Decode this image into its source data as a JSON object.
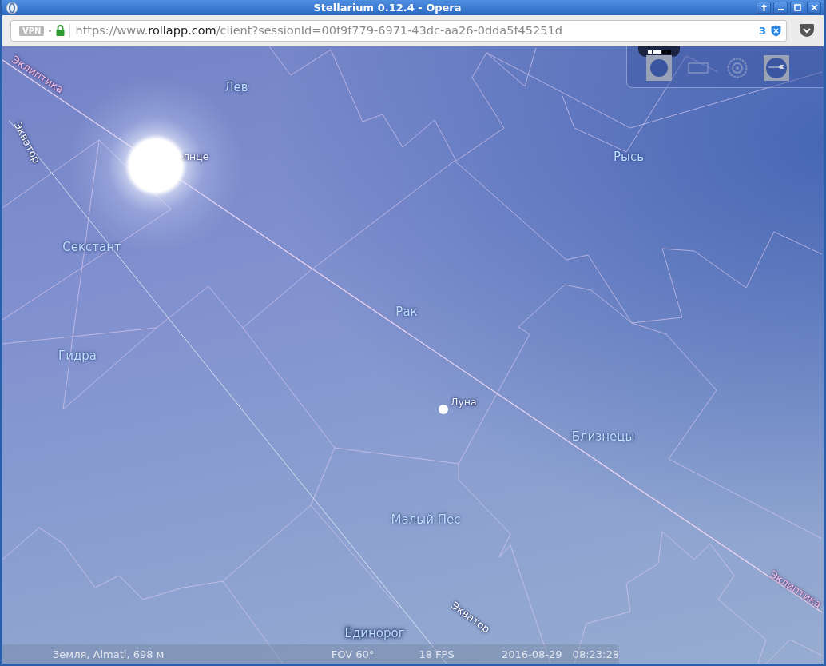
{
  "window": {
    "title": "Stellarium 0.12.4 - Opera"
  },
  "address_bar": {
    "vpn": "VPN",
    "url_prefix": "https://www.",
    "url_host": "rollapp.com",
    "url_path": "/client?sessionId=00f9f779-6971-43dc-aa26-0dda5f45251d",
    "blocked_count": "3"
  },
  "sky": {
    "constellations": [
      {
        "name": "Лев"
      },
      {
        "name": "Рысь"
      },
      {
        "name": "Секстант"
      },
      {
        "name": "Рак"
      },
      {
        "name": "Гидра"
      },
      {
        "name": "Близнецы"
      },
      {
        "name": "Малый Пес"
      },
      {
        "name": "Единорог"
      }
    ],
    "lines": [
      {
        "kind": "ecliptic",
        "label": "Эклиптика"
      },
      {
        "kind": "equator",
        "label": "Экватор"
      },
      {
        "kind": "equator",
        "label": "Экватор"
      },
      {
        "kind": "ecliptic",
        "label": "Эклиптика"
      }
    ],
    "objects": [
      {
        "kind": "sun",
        "label": "лнце"
      },
      {
        "kind": "moon",
        "label": "Луна"
      }
    ]
  },
  "toolbar": {
    "buttons": [
      {
        "kind": "disk",
        "on": true
      },
      {
        "kind": "frame",
        "on": false
      },
      {
        "kind": "target",
        "on": false
      },
      {
        "kind": "wrench",
        "on": true
      }
    ]
  },
  "status_bar": {
    "location": "Земля, Almati, 698 м",
    "fov": "FOV 60°",
    "fps": "18 FPS",
    "date": "2016-08-29",
    "time": "08:23:28"
  }
}
